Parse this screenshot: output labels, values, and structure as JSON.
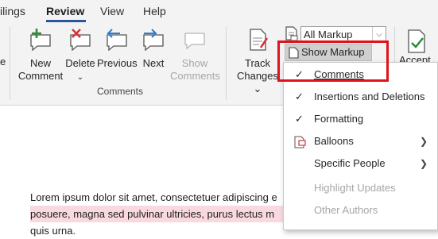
{
  "tabs": [
    {
      "label": "ilings",
      "active": false
    },
    {
      "label": "Review",
      "active": true
    },
    {
      "label": "View",
      "active": false
    },
    {
      "label": "Help",
      "active": false
    }
  ],
  "ribbon": {
    "comments_group": {
      "label": "Comments",
      "buttons": {
        "new_comment": {
          "line1": "New",
          "line2": "Comment",
          "icon": "new-comment-icon"
        },
        "delete": {
          "line1": "Delete",
          "line2": "⌄",
          "icon": "delete-comment-icon"
        },
        "previous": {
          "line1": "Previous",
          "icon": "previous-comment-icon"
        },
        "next": {
          "line1": "Next",
          "icon": "next-comment-icon"
        },
        "show_comments": {
          "line1": "Show",
          "line2": "Comments",
          "icon": "show-comments-icon",
          "disabled": true
        }
      }
    },
    "tracking_group": {
      "track_changes": {
        "line1": "Track",
        "line2": "Changes ⌄",
        "icon": "track-changes-icon"
      },
      "markup_select_value": "All Markup",
      "show_markup_label": "Show Markup",
      "accept_partial": "Accept"
    },
    "left_edge_label": "e"
  },
  "menu": {
    "items": [
      {
        "label": "Comments",
        "checked": true,
        "disabled": false
      },
      {
        "label": "Insertions and Deletions",
        "checked": true,
        "disabled": false
      },
      {
        "label": "Formatting",
        "checked": true,
        "disabled": false
      },
      {
        "label": "Balloons",
        "icon": "balloons-icon",
        "submenu": true,
        "disabled": false
      },
      {
        "label": "Specific People",
        "submenu": true,
        "disabled": false
      },
      {
        "label": "Highlight Updates",
        "disabled": true
      },
      {
        "label": "Other Authors",
        "disabled": true
      }
    ]
  },
  "document": {
    "line1": "Lorem ipsum dolor sit amet, consectetuer adipiscing e",
    "line2": "posuere, magna sed pulvinar ultricies, purus lectus m",
    "line3": "quis urna."
  },
  "colors": {
    "accent": "#2b579a",
    "highlight_box": "#e0121b",
    "insert_icon_green": "#2e8b3a",
    "delete_icon_red": "#d13438",
    "nav_icon_blue": "#2b7cd3"
  }
}
